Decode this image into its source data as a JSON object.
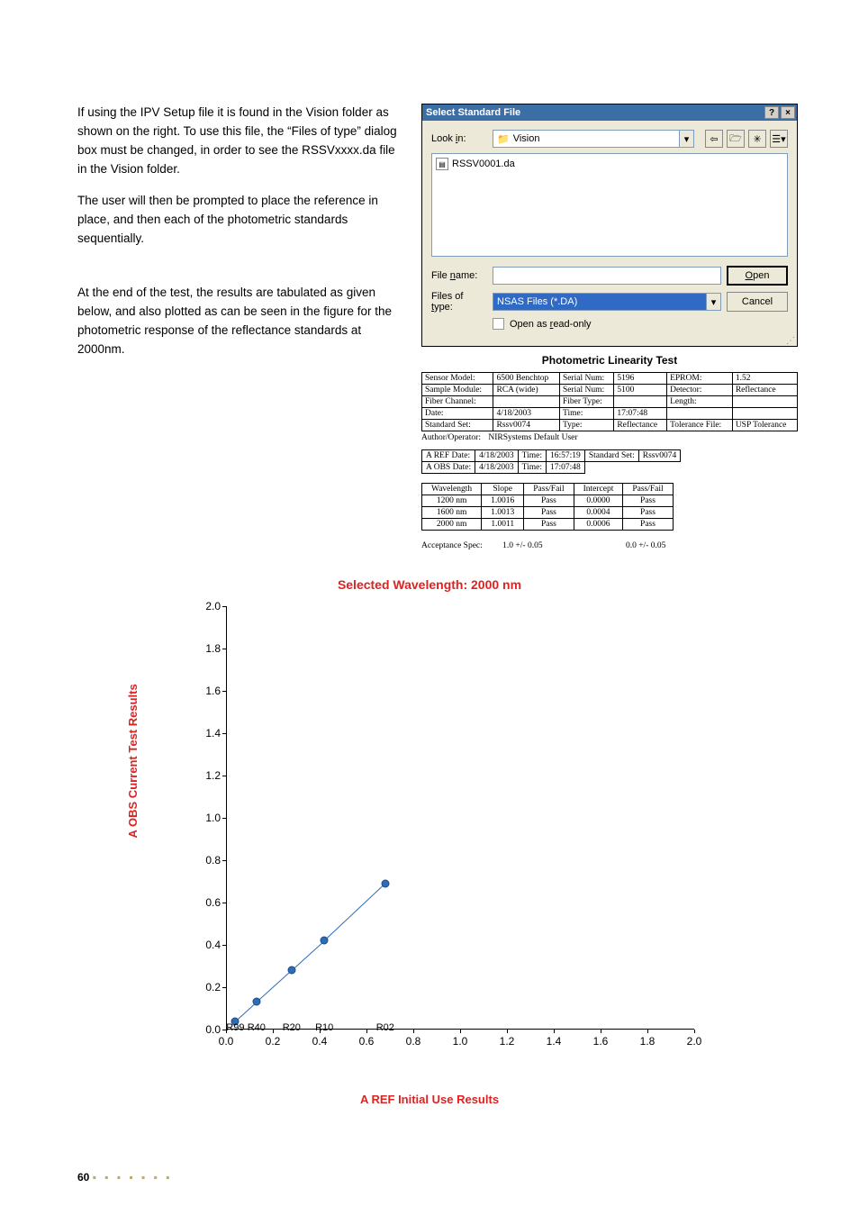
{
  "body": {
    "para1": "If using the IPV Setup file it is found in the Vision folder as shown on the right. To use this file, the “Files of type” dialog box must be changed, in order to see the RSSVxxxx.da file in the Vision folder.",
    "para2": "The user will then be prompted to place the reference in place, and then each of the photometric standards sequentially.",
    "para3": "At the end of the test, the results are tabulated as given below, and also plotted as can be seen in the figure for the photometric response of the reflectance standards at 2000nm."
  },
  "dialog": {
    "title": "Select Standard File",
    "look_in_label": "Look in:",
    "look_in_value": "Vision",
    "file_item": "RSSV0001.da",
    "filename_label": "File name:",
    "filename_value": "",
    "filetype_label": "Files of type:",
    "filetype_value": "NSAS Files (*.DA)",
    "readonly_label": "Open as read-only",
    "open_btn": "Open",
    "cancel_btn": "Cancel",
    "help_btn": "?",
    "close_btn": "×"
  },
  "plt": {
    "title": "Photometric Linearity Test",
    "info_rows": [
      [
        "Sensor Model:",
        "6500 Benchtop",
        "Serial Num:",
        "5196",
        "EPROM:",
        "1.52"
      ],
      [
        "Sample Module:",
        "RCA (wide)",
        "Serial Num:",
        "5100",
        "Detector:",
        "Reflectance"
      ],
      [
        "Fiber Channel:",
        "",
        "Fiber Type:",
        "",
        "Length:",
        ""
      ],
      [
        "Date:",
        "4/18/2003",
        "Time:",
        "17:07:48",
        "",
        ""
      ],
      [
        "Standard Set:",
        "Rssv0074",
        "Type:",
        "Reflectance",
        "Tolerance File:",
        "USP Tolerance"
      ]
    ],
    "author_label": "Author/Operator:",
    "author_value": "NIRSystems Default User",
    "dates": [
      [
        "A REF Date:",
        "4/18/2003",
        "Time:",
        "16:57:19",
        "Standard Set:",
        "Rssv0074"
      ],
      [
        "A OBS Date:",
        "4/18/2003",
        "Time:",
        "17:07:48"
      ]
    ],
    "wl_header": [
      "Wavelength",
      "Slope",
      "Pass/Fail",
      "Intercept",
      "Pass/Fail"
    ],
    "wl_rows": [
      [
        "1200 nm",
        "1.0016",
        "Pass",
        "0.0000",
        "Pass"
      ],
      [
        "1600 nm",
        "1.0013",
        "Pass",
        "0.0004",
        "Pass"
      ],
      [
        "2000 nm",
        "1.0011",
        "Pass",
        "0.0006",
        "Pass"
      ]
    ],
    "spec_label": "Acceptance Spec:",
    "spec_slope": "1.0 +/- 0.05",
    "spec_intercept": "0.0 +/- 0.05"
  },
  "chart_data": {
    "type": "scatter",
    "title": "Selected Wavelength: 2000 nm",
    "xlabel": "A REF Initial Use Results",
    "ylabel": "A OBS Current Test Results",
    "xlim": [
      0.0,
      2.0
    ],
    "ylim": [
      0.0,
      2.0
    ],
    "x_ticks": [
      0.0,
      0.2,
      0.4,
      0.6,
      0.8,
      1.0,
      1.2,
      1.4,
      1.6,
      1.8,
      2.0
    ],
    "y_ticks": [
      0.0,
      0.2,
      0.4,
      0.6,
      0.8,
      1.0,
      1.2,
      1.4,
      1.6,
      1.8,
      2.0
    ],
    "points": [
      {
        "label": "R99",
        "x": 0.04,
        "y": 0.04
      },
      {
        "label": "R40",
        "x": 0.13,
        "y": 0.13
      },
      {
        "label": "R20",
        "x": 0.28,
        "y": 0.28
      },
      {
        "label": "R10",
        "x": 0.42,
        "y": 0.42
      },
      {
        "label": "R02",
        "x": 0.68,
        "y": 0.69
      }
    ]
  },
  "footer": {
    "page": "60",
    "dots": "▪ ▪ ▪ ▪ ▪ ▪ ▪"
  }
}
